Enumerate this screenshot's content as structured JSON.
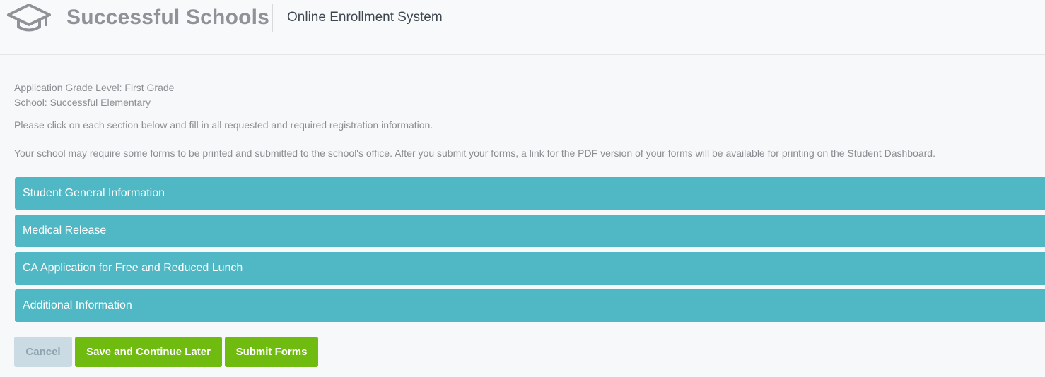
{
  "header": {
    "brand": "Successful Schools",
    "system_title": "Online Enrollment System",
    "logo_icon": "graduation-cap-icon"
  },
  "info": {
    "grade_line": "Application Grade Level: First Grade",
    "school_line": "School: Successful Elementary",
    "instruction": "Please click on each section below and fill in all requested and required registration information.",
    "note": "Your school may require some forms to be printed and submitted to the school's office. After you submit your forms, a link for the PDF version of your forms will be available for printing on the Student Dashboard."
  },
  "sections": [
    {
      "label": "Student General Information"
    },
    {
      "label": "Medical Release"
    },
    {
      "label": "CA Application for Free and Reduced Lunch"
    },
    {
      "label": "Additional Information"
    }
  ],
  "actions": {
    "cancel_label": "Cancel",
    "save_label": "Save and Continue Later",
    "submit_label": "Submit Forms"
  },
  "colors": {
    "section_bg": "#4fb8c4",
    "primary_button": "#6fbb0f",
    "cancel_button": "#cadbe3"
  }
}
